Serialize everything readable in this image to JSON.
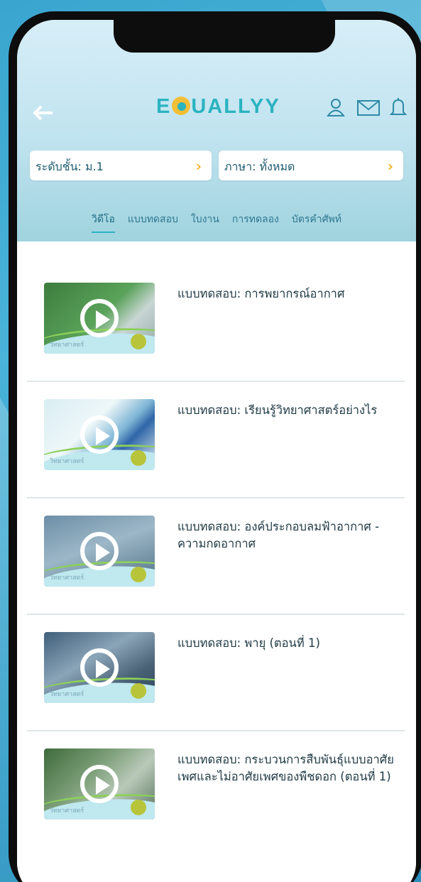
{
  "app": {
    "logo_text_left": "E",
    "logo_text_right": "UALLYY",
    "colors": {
      "accent": "#2bb3c0",
      "chevron": "#f2b62d",
      "text": "#1f3a45"
    }
  },
  "header": {
    "icons": [
      "back-arrow-icon",
      "user-icon",
      "mail-icon",
      "bell-icon"
    ]
  },
  "filters": {
    "level_label": "ระดับชั้น: ม.1",
    "language_label": "ภาษา: ทั้งหมด"
  },
  "tabs": [
    {
      "label": "วิดีโอ",
      "active": true
    },
    {
      "label": "แบบทดสอบ",
      "active": false
    },
    {
      "label": "ใบงาน",
      "active": false
    },
    {
      "label": "การทดลอง",
      "active": false
    },
    {
      "label": "บัตรคำศัพท์",
      "active": false
    }
  ],
  "items": [
    {
      "title": "แบบทดสอบ: การพยากรณ์อากาศ",
      "thumb_tag": "วิทยาศาสตร์"
    },
    {
      "title": "แบบทดสอบ: เรียนรู้วิทยาศาสตร์อย่างไร",
      "thumb_tag": "วิทยาศาสตร์"
    },
    {
      "title": "แบบทดสอบ: องค์ประกอบลมฟ้าอากาศ - ความกดอากาศ",
      "thumb_tag": "วิทยาศาสตร์"
    },
    {
      "title": "แบบทดสอบ: พายุ (ตอนที่ 1)",
      "thumb_tag": "วิทยาศาสตร์"
    },
    {
      "title": "แบบทดสอบ: กระบวนการสืบพันธุ์แบบอาศัยเพศและไม่อาศัยเพศของพืชดอก (ตอนที่ 1)",
      "thumb_tag": "วิทยาศาสตร์"
    }
  ]
}
